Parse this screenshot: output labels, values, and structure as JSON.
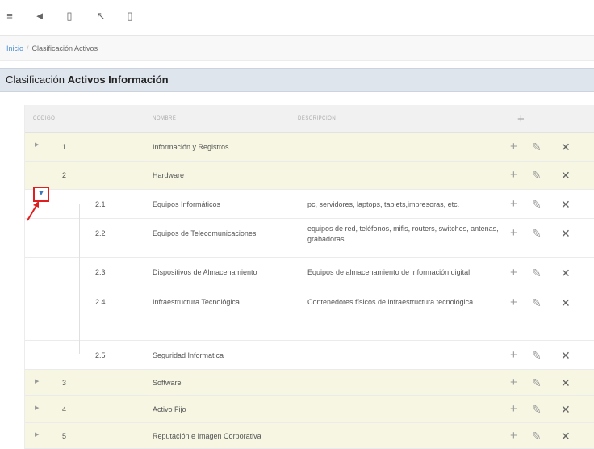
{
  "toolbar": {
    "icons": [
      {
        "name": "menu-icon",
        "glyph": "≡"
      },
      {
        "name": "send-icon",
        "glyph": "◄"
      },
      {
        "name": "document-icon",
        "glyph": "▯"
      },
      {
        "name": "pin-icon",
        "glyph": "↖"
      },
      {
        "name": "file-icon",
        "glyph": "▯"
      }
    ]
  },
  "breadcrumb": {
    "home": "Inicio",
    "separator": "/",
    "current": "Clasificación Activos"
  },
  "page_title": {
    "prefix": "Clasificación",
    "bold": "Activos Información"
  },
  "table": {
    "headers": {
      "code": "CÓDIGO",
      "name": "NOMBRE",
      "description": "DESCRIPCIÓN",
      "add": "+"
    },
    "rows": [
      {
        "code": "1",
        "name": "Información y Registros",
        "description": "",
        "expander": "▶"
      },
      {
        "code": "2",
        "name": "Hardware",
        "description": "",
        "expander": "▼"
      },
      {
        "code": "2.1",
        "name": "Equipos Informáticos",
        "description": "pc, servidores, laptops, tablets,impresoras, etc."
      },
      {
        "code": "2.2",
        "name": "Equipos de Telecomunicaciones",
        "description": "equipos de red, teléfonos, mifis, routers, switches, antenas, grabadoras"
      },
      {
        "code": "2.3",
        "name": "Dispositivos de Almacenamiento",
        "description": "Equipos de almacenamiento de información digital"
      },
      {
        "code": "2.4",
        "name": "Infraestructura Tecnológica",
        "description": "Contenedores físicos de infraestructura tecnológica"
      },
      {
        "code": "2.5",
        "name": "Seguridad Informatica",
        "description": ""
      },
      {
        "code": "3",
        "name": "Software",
        "description": "",
        "expander": "▶"
      },
      {
        "code": "4",
        "name": "Activo Fijo",
        "description": "",
        "expander": "▶"
      },
      {
        "code": "5",
        "name": "Reputación e Imagen Corporativa",
        "description": "",
        "expander": "▶"
      }
    ],
    "actions": {
      "add": "+",
      "edit": "✎",
      "delete": "✕"
    }
  },
  "colors": {
    "parent_row": "#f6f6e3",
    "header_band": "#dfe5ed",
    "highlight_box": "#e02020",
    "link": "#4a8fd0"
  }
}
